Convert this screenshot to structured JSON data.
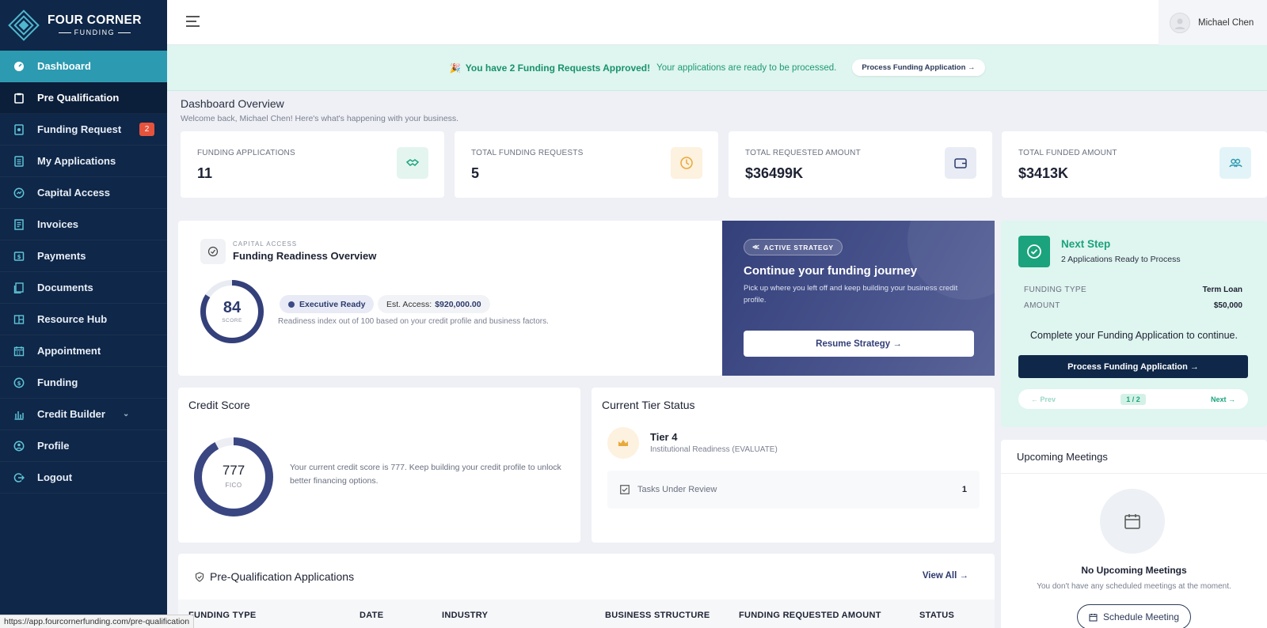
{
  "brand": {
    "name_line1": "FOUR CORNER",
    "name_line2": "FUNDING"
  },
  "sidebar": {
    "items": [
      {
        "label": "Dashboard",
        "icon": "dashboard-icon",
        "state": "active"
      },
      {
        "label": "Pre Qualification",
        "icon": "clipboard-icon",
        "state": "hover"
      },
      {
        "label": "Funding Request",
        "icon": "request-icon",
        "badge": "2"
      },
      {
        "label": "My Applications",
        "icon": "list-icon"
      },
      {
        "label": "Capital Access",
        "icon": "gauge-icon"
      },
      {
        "label": "Invoices",
        "icon": "invoice-icon"
      },
      {
        "label": "Payments",
        "icon": "payment-icon"
      },
      {
        "label": "Documents",
        "icon": "documents-icon"
      },
      {
        "label": "Resource Hub",
        "icon": "hub-icon"
      },
      {
        "label": "Appointment",
        "icon": "calendar-icon"
      },
      {
        "label": "Funding",
        "icon": "coin-icon"
      },
      {
        "label": "Credit Builder",
        "icon": "bank-icon",
        "has_chevron": true
      },
      {
        "label": "Profile",
        "icon": "profile-icon"
      },
      {
        "label": "Logout",
        "icon": "logout-icon"
      }
    ]
  },
  "header": {
    "user_name": "Michael Chen"
  },
  "banner": {
    "emoji": "🎉",
    "strong": "You have 2 Funding Requests Approved!",
    "text": "Your applications are ready to be processed.",
    "button": "Process Funding Application →"
  },
  "overview": {
    "title": "Dashboard Overview",
    "subtitle": "Welcome back, Michael Chen! Here's what's happening with your business."
  },
  "stats": [
    {
      "label": "FUNDING APPLICATIONS",
      "value": "11",
      "icon": "handshake-icon",
      "color": "#1aa37c",
      "bg": "#e3f5ee"
    },
    {
      "label": "TOTAL FUNDING REQUESTS",
      "value": "5",
      "icon": "clock-icon",
      "color": "#e8a93a",
      "bg": "#fdf1df"
    },
    {
      "label": "TOTAL REQUESTED AMOUNT",
      "value": "$36499K",
      "icon": "wallet-icon",
      "color": "#2c3a6e",
      "bg": "#e9ecf4"
    },
    {
      "label": "TOTAL FUNDED AMOUNT",
      "value": "$3413K",
      "icon": "users-icon",
      "color": "#2c9ab1",
      "bg": "#e2f4f7"
    }
  ],
  "readiness": {
    "kicker": "CAPITAL ACCESS",
    "title": "Funding Readiness Overview",
    "score": "84",
    "score_label": "SCORE",
    "score_fraction": 0.84,
    "badge": "Executive Ready",
    "est_label": "Est. Access:",
    "est_value": "$920,000.00",
    "note": "Readiness index out of 100 based on your credit profile and business factors."
  },
  "strategy": {
    "pill": "ACTIVE STRATEGY",
    "title": "Continue your funding journey",
    "desc": "Pick up where you left off and keep building your business credit profile.",
    "button": "Resume Strategy →"
  },
  "next_step": {
    "title": "Next Step",
    "subtitle": "2 Applications Ready to Process",
    "funding_type_label": "FUNDING TYPE",
    "funding_type_value": "Term Loan",
    "amount_label": "AMOUNT",
    "amount_value": "$50,000",
    "message": "Complete your Funding Application to continue.",
    "button": "Process Funding Application →",
    "prev": "← Prev",
    "page": "1 / 2",
    "next": "Next →"
  },
  "credit": {
    "title": "Credit Score",
    "score": "777",
    "unit": "FICO",
    "fraction": 0.92,
    "note": "Your current credit score is 777. Keep building your credit profile to unlock better financing options."
  },
  "tier": {
    "title": "Current Tier Status",
    "name": "Tier 4",
    "sub": "Institutional Readiness (EVALUATE)",
    "tasks_label": "Tasks Under Review",
    "tasks_count": "1"
  },
  "meetings": {
    "title": "Upcoming Meetings",
    "empty_title": "No Upcoming Meetings",
    "empty_desc": "You don't have any scheduled meetings at the moment.",
    "button": "Schedule Meeting"
  },
  "prequal": {
    "title": "Pre-Qualification Applications",
    "view_all": "View All →",
    "columns": [
      "FUNDING TYPE",
      "DATE",
      "INDUSTRY",
      "BUSINESS STRUCTURE",
      "FUNDING REQUESTED AMOUNT",
      "STATUS"
    ]
  },
  "status_url": "https://app.fourcornerfunding.com/pre-qualification"
}
